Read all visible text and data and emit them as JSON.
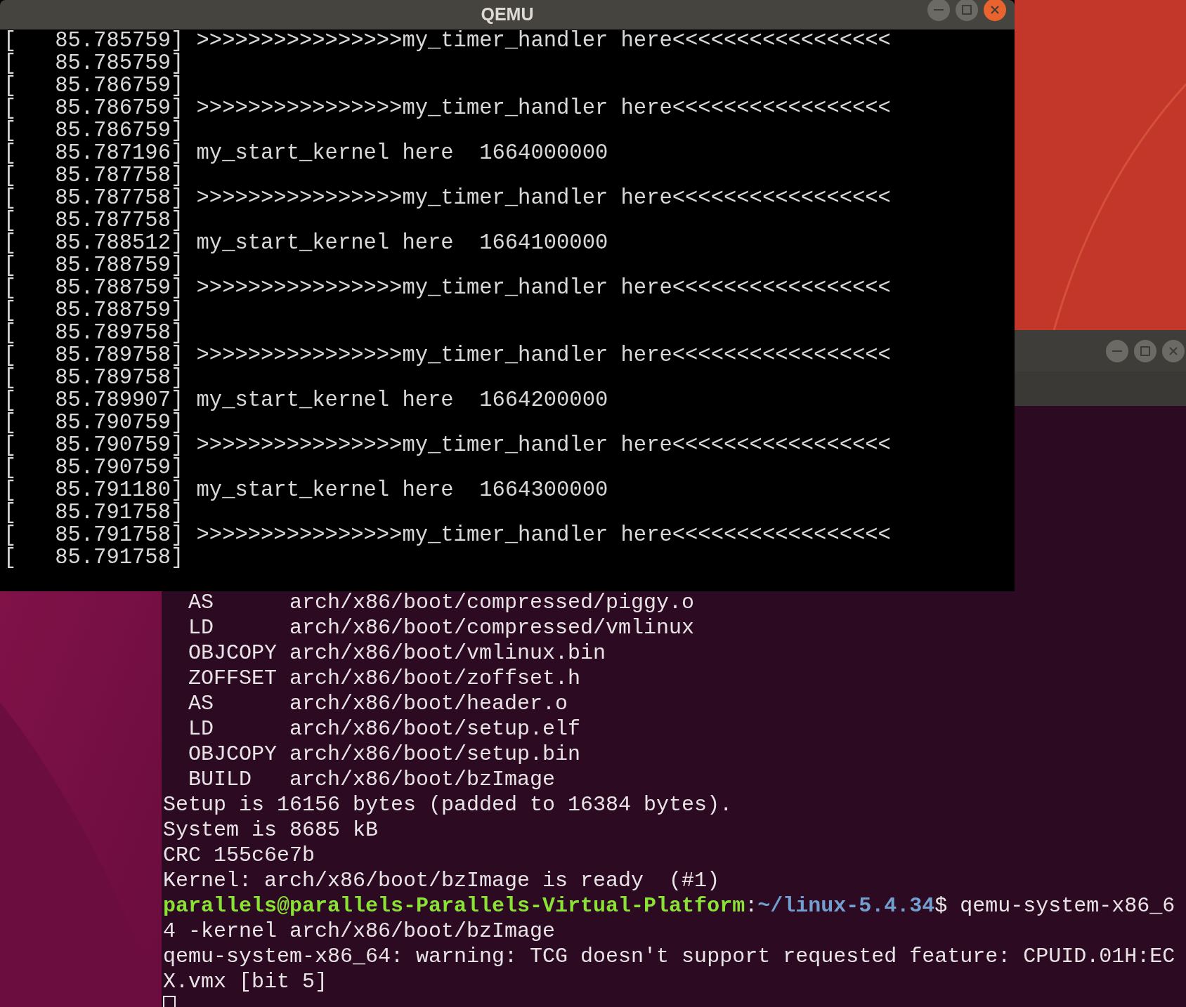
{
  "qemu_window": {
    "title": "QEMU",
    "console_lines": [
      "[   85.785759] >>>>>>>>>>>>>>>>my_timer_handler here<<<<<<<<<<<<<<<<<",
      "[   85.785759]",
      "[   85.786759]",
      "[   85.786759] >>>>>>>>>>>>>>>>my_timer_handler here<<<<<<<<<<<<<<<<<",
      "[   85.786759]",
      "[   85.787196] my_start_kernel here  1664000000",
      "[   85.787758]",
      "[   85.787758] >>>>>>>>>>>>>>>>my_timer_handler here<<<<<<<<<<<<<<<<<",
      "[   85.787758]",
      "[   85.788512] my_start_kernel here  1664100000",
      "[   85.788759]",
      "[   85.788759] >>>>>>>>>>>>>>>>my_timer_handler here<<<<<<<<<<<<<<<<<",
      "[   85.788759]",
      "[   85.789758]",
      "[   85.789758] >>>>>>>>>>>>>>>>my_timer_handler here<<<<<<<<<<<<<<<<<",
      "[   85.789758]",
      "[   85.789907] my_start_kernel here  1664200000",
      "[   85.790759]",
      "[   85.790759] >>>>>>>>>>>>>>>>my_timer_handler here<<<<<<<<<<<<<<<<<",
      "[   85.790759]",
      "[   85.791180] my_start_kernel here  1664300000",
      "[   85.791758]",
      "[   85.791758] >>>>>>>>>>>>>>>>my_timer_handler here<<<<<<<<<<<<<<<<<",
      "[   85.791758]"
    ]
  },
  "terminal_window": {
    "output_before": [
      "  AS      arch/x86/boot/compressed/piggy.o",
      "  LD      arch/x86/boot/compressed/vmlinux",
      "  OBJCOPY arch/x86/boot/vmlinux.bin",
      "  ZOFFSET arch/x86/boot/zoffset.h",
      "  AS      arch/x86/boot/header.o",
      "  LD      arch/x86/boot/setup.elf",
      "  OBJCOPY arch/x86/boot/setup.bin",
      "  BUILD   arch/x86/boot/bzImage",
      "Setup is 16156 bytes (padded to 16384 bytes).",
      "System is 8685 kB",
      "CRC 155c6e7b",
      "Kernel: arch/x86/boot/bzImage is ready  (#1)"
    ],
    "prompt": {
      "user": "parallels@parallels-Parallels-Virtual-Platform",
      "separator": ":",
      "path": "~/linux-5.4.34",
      "command": "$ qemu-system-x86_6"
    },
    "output_after": [
      "4 -kernel arch/x86/boot/bzImage",
      "qemu-system-x86_64: warning: TCG doesn't support requested feature: CPUID.01H:EC",
      "X.vmx [bit 5]"
    ]
  }
}
